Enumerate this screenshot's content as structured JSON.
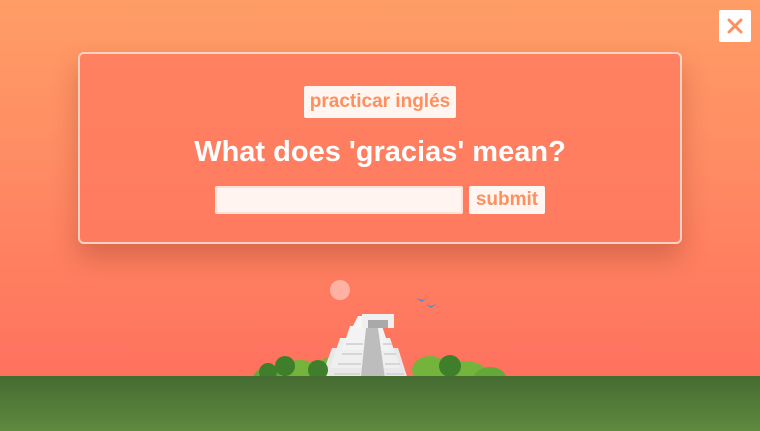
{
  "close": {
    "icon": "close-icon"
  },
  "card": {
    "language_button": "practicar inglés",
    "question": "What does 'gracias' mean?",
    "answer": {
      "value": "",
      "placeholder": ""
    },
    "submit_label": "submit"
  },
  "colors": {
    "sky_top": "#ff9d66",
    "sky_bottom": "#ff6b5d",
    "accent_text": "#ff8f5e",
    "ground": "#4f7a36"
  }
}
